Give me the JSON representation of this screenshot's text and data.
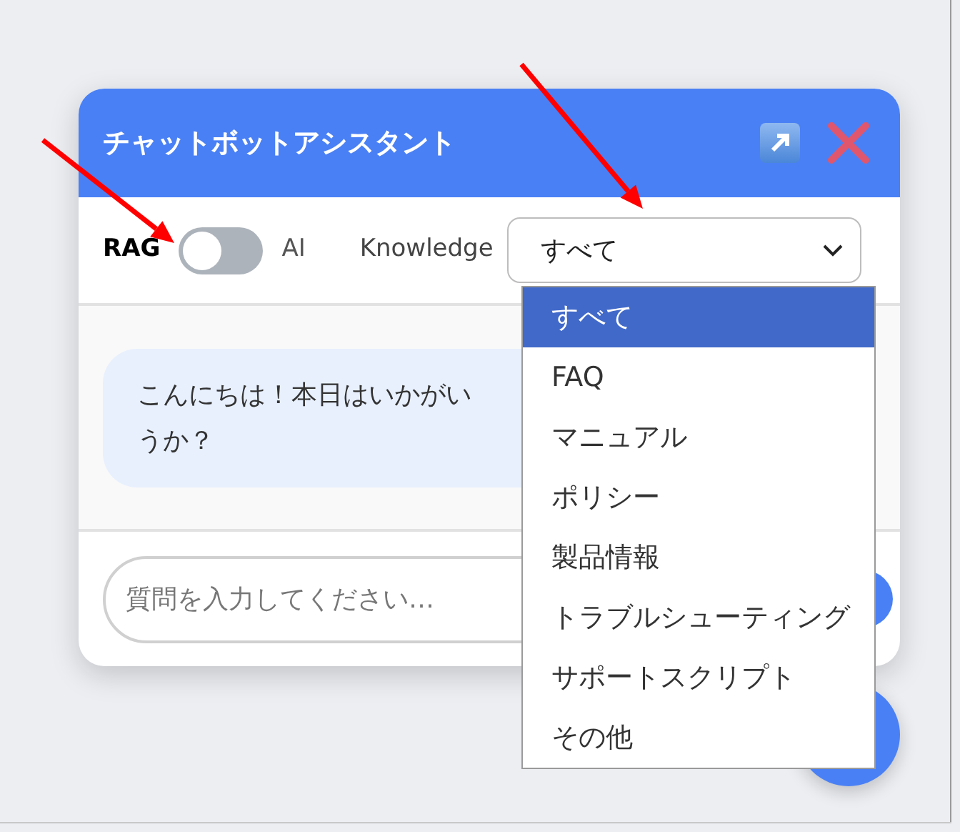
{
  "window": {
    "title": "チャットボットアシスタント"
  },
  "mode_toggle": {
    "left_label": "RAG",
    "right_label": "AI",
    "on": false
  },
  "knowledge": {
    "label": "Knowledge",
    "value": "すべて",
    "expanded": true,
    "options": [
      {
        "label": "すべて",
        "selected": true
      },
      {
        "label": "FAQ",
        "selected": false
      },
      {
        "label": "マニュアル",
        "selected": false
      },
      {
        "label": "ポリシー",
        "selected": false
      },
      {
        "label": "製品情報",
        "selected": false
      },
      {
        "label": "トラブルシューティング",
        "selected": false
      },
      {
        "label": "サポートスクリプト",
        "selected": false
      },
      {
        "label": "その他",
        "selected": false
      }
    ]
  },
  "messages": [
    {
      "lines": [
        "こんにちは！本日はいかがい",
        "うか？"
      ]
    }
  ],
  "input": {
    "placeholder": "質問を入力してください…"
  }
}
